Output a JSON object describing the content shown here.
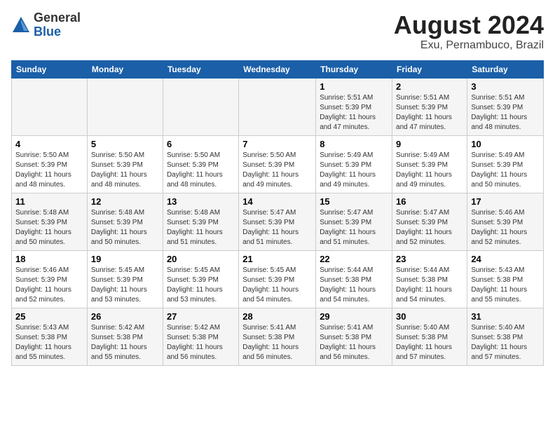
{
  "header": {
    "logo_line1": "General",
    "logo_line2": "Blue",
    "title": "August 2024",
    "subtitle": "Exu, Pernambuco, Brazil"
  },
  "days_of_week": [
    "Sunday",
    "Monday",
    "Tuesday",
    "Wednesday",
    "Thursday",
    "Friday",
    "Saturday"
  ],
  "weeks": [
    [
      {
        "day": "",
        "info": ""
      },
      {
        "day": "",
        "info": ""
      },
      {
        "day": "",
        "info": ""
      },
      {
        "day": "",
        "info": ""
      },
      {
        "day": "1",
        "info": "Sunrise: 5:51 AM\nSunset: 5:39 PM\nDaylight: 11 hours\nand 47 minutes."
      },
      {
        "day": "2",
        "info": "Sunrise: 5:51 AM\nSunset: 5:39 PM\nDaylight: 11 hours\nand 47 minutes."
      },
      {
        "day": "3",
        "info": "Sunrise: 5:51 AM\nSunset: 5:39 PM\nDaylight: 11 hours\nand 48 minutes."
      }
    ],
    [
      {
        "day": "4",
        "info": "Sunrise: 5:50 AM\nSunset: 5:39 PM\nDaylight: 11 hours\nand 48 minutes."
      },
      {
        "day": "5",
        "info": "Sunrise: 5:50 AM\nSunset: 5:39 PM\nDaylight: 11 hours\nand 48 minutes."
      },
      {
        "day": "6",
        "info": "Sunrise: 5:50 AM\nSunset: 5:39 PM\nDaylight: 11 hours\nand 48 minutes."
      },
      {
        "day": "7",
        "info": "Sunrise: 5:50 AM\nSunset: 5:39 PM\nDaylight: 11 hours\nand 49 minutes."
      },
      {
        "day": "8",
        "info": "Sunrise: 5:49 AM\nSunset: 5:39 PM\nDaylight: 11 hours\nand 49 minutes."
      },
      {
        "day": "9",
        "info": "Sunrise: 5:49 AM\nSunset: 5:39 PM\nDaylight: 11 hours\nand 49 minutes."
      },
      {
        "day": "10",
        "info": "Sunrise: 5:49 AM\nSunset: 5:39 PM\nDaylight: 11 hours\nand 50 minutes."
      }
    ],
    [
      {
        "day": "11",
        "info": "Sunrise: 5:48 AM\nSunset: 5:39 PM\nDaylight: 11 hours\nand 50 minutes."
      },
      {
        "day": "12",
        "info": "Sunrise: 5:48 AM\nSunset: 5:39 PM\nDaylight: 11 hours\nand 50 minutes."
      },
      {
        "day": "13",
        "info": "Sunrise: 5:48 AM\nSunset: 5:39 PM\nDaylight: 11 hours\nand 51 minutes."
      },
      {
        "day": "14",
        "info": "Sunrise: 5:47 AM\nSunset: 5:39 PM\nDaylight: 11 hours\nand 51 minutes."
      },
      {
        "day": "15",
        "info": "Sunrise: 5:47 AM\nSunset: 5:39 PM\nDaylight: 11 hours\nand 51 minutes."
      },
      {
        "day": "16",
        "info": "Sunrise: 5:47 AM\nSunset: 5:39 PM\nDaylight: 11 hours\nand 52 minutes."
      },
      {
        "day": "17",
        "info": "Sunrise: 5:46 AM\nSunset: 5:39 PM\nDaylight: 11 hours\nand 52 minutes."
      }
    ],
    [
      {
        "day": "18",
        "info": "Sunrise: 5:46 AM\nSunset: 5:39 PM\nDaylight: 11 hours\nand 52 minutes."
      },
      {
        "day": "19",
        "info": "Sunrise: 5:45 AM\nSunset: 5:39 PM\nDaylight: 11 hours\nand 53 minutes."
      },
      {
        "day": "20",
        "info": "Sunrise: 5:45 AM\nSunset: 5:39 PM\nDaylight: 11 hours\nand 53 minutes."
      },
      {
        "day": "21",
        "info": "Sunrise: 5:45 AM\nSunset: 5:39 PM\nDaylight: 11 hours\nand 54 minutes."
      },
      {
        "day": "22",
        "info": "Sunrise: 5:44 AM\nSunset: 5:38 PM\nDaylight: 11 hours\nand 54 minutes."
      },
      {
        "day": "23",
        "info": "Sunrise: 5:44 AM\nSunset: 5:38 PM\nDaylight: 11 hours\nand 54 minutes."
      },
      {
        "day": "24",
        "info": "Sunrise: 5:43 AM\nSunset: 5:38 PM\nDaylight: 11 hours\nand 55 minutes."
      }
    ],
    [
      {
        "day": "25",
        "info": "Sunrise: 5:43 AM\nSunset: 5:38 PM\nDaylight: 11 hours\nand 55 minutes."
      },
      {
        "day": "26",
        "info": "Sunrise: 5:42 AM\nSunset: 5:38 PM\nDaylight: 11 hours\nand 55 minutes."
      },
      {
        "day": "27",
        "info": "Sunrise: 5:42 AM\nSunset: 5:38 PM\nDaylight: 11 hours\nand 56 minutes."
      },
      {
        "day": "28",
        "info": "Sunrise: 5:41 AM\nSunset: 5:38 PM\nDaylight: 11 hours\nand 56 minutes."
      },
      {
        "day": "29",
        "info": "Sunrise: 5:41 AM\nSunset: 5:38 PM\nDaylight: 11 hours\nand 56 minutes."
      },
      {
        "day": "30",
        "info": "Sunrise: 5:40 AM\nSunset: 5:38 PM\nDaylight: 11 hours\nand 57 minutes."
      },
      {
        "day": "31",
        "info": "Sunrise: 5:40 AM\nSunset: 5:38 PM\nDaylight: 11 hours\nand 57 minutes."
      }
    ]
  ]
}
